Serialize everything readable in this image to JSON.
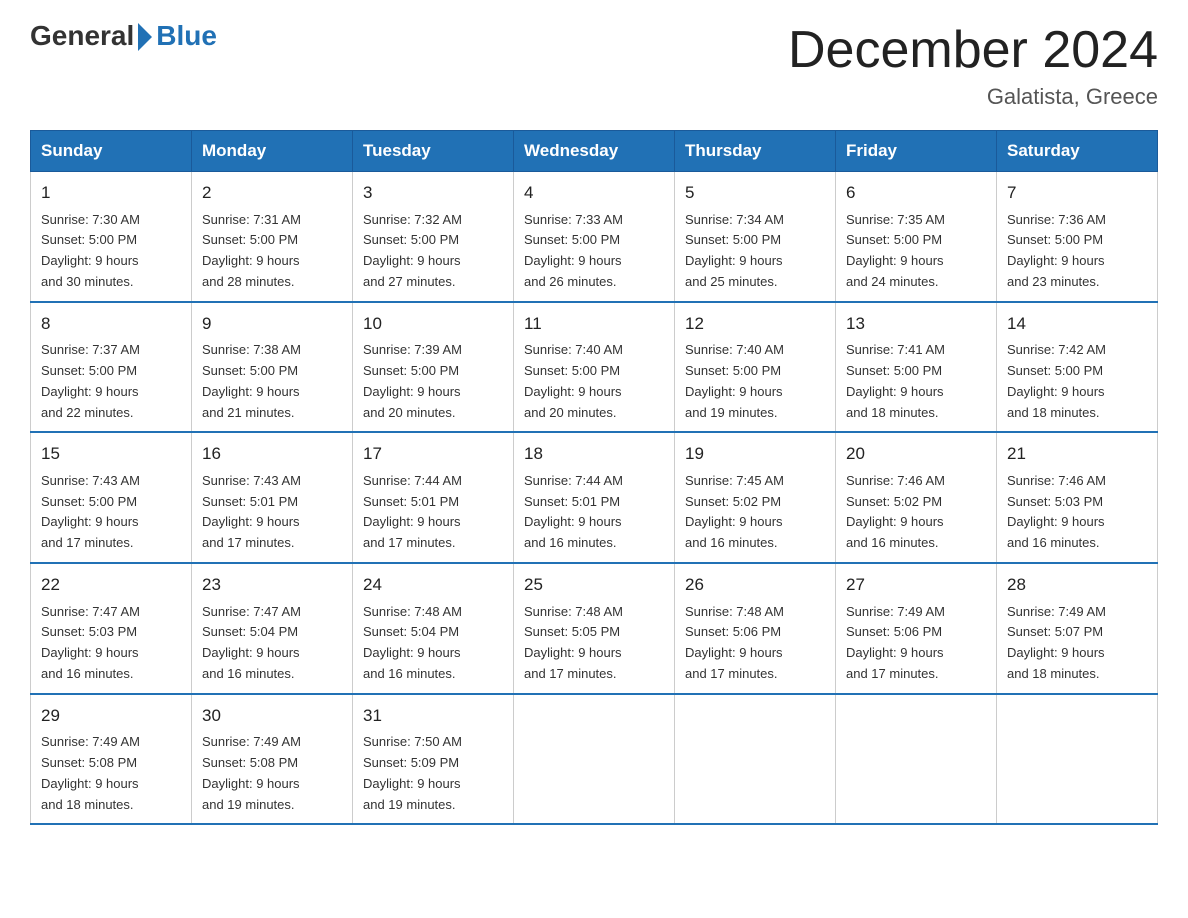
{
  "logo": {
    "general": "General",
    "blue": "Blue"
  },
  "header": {
    "title": "December 2024",
    "subtitle": "Galatista, Greece"
  },
  "days_of_week": [
    "Sunday",
    "Monday",
    "Tuesday",
    "Wednesday",
    "Thursday",
    "Friday",
    "Saturday"
  ],
  "weeks": [
    [
      {
        "day": "1",
        "sunrise": "7:30 AM",
        "sunset": "5:00 PM",
        "daylight": "9 hours and 30 minutes."
      },
      {
        "day": "2",
        "sunrise": "7:31 AM",
        "sunset": "5:00 PM",
        "daylight": "9 hours and 28 minutes."
      },
      {
        "day": "3",
        "sunrise": "7:32 AM",
        "sunset": "5:00 PM",
        "daylight": "9 hours and 27 minutes."
      },
      {
        "day": "4",
        "sunrise": "7:33 AM",
        "sunset": "5:00 PM",
        "daylight": "9 hours and 26 minutes."
      },
      {
        "day": "5",
        "sunrise": "7:34 AM",
        "sunset": "5:00 PM",
        "daylight": "9 hours and 25 minutes."
      },
      {
        "day": "6",
        "sunrise": "7:35 AM",
        "sunset": "5:00 PM",
        "daylight": "9 hours and 24 minutes."
      },
      {
        "day": "7",
        "sunrise": "7:36 AM",
        "sunset": "5:00 PM",
        "daylight": "9 hours and 23 minutes."
      }
    ],
    [
      {
        "day": "8",
        "sunrise": "7:37 AM",
        "sunset": "5:00 PM",
        "daylight": "9 hours and 22 minutes."
      },
      {
        "day": "9",
        "sunrise": "7:38 AM",
        "sunset": "5:00 PM",
        "daylight": "9 hours and 21 minutes."
      },
      {
        "day": "10",
        "sunrise": "7:39 AM",
        "sunset": "5:00 PM",
        "daylight": "9 hours and 20 minutes."
      },
      {
        "day": "11",
        "sunrise": "7:40 AM",
        "sunset": "5:00 PM",
        "daylight": "9 hours and 20 minutes."
      },
      {
        "day": "12",
        "sunrise": "7:40 AM",
        "sunset": "5:00 PM",
        "daylight": "9 hours and 19 minutes."
      },
      {
        "day": "13",
        "sunrise": "7:41 AM",
        "sunset": "5:00 PM",
        "daylight": "9 hours and 18 minutes."
      },
      {
        "day": "14",
        "sunrise": "7:42 AM",
        "sunset": "5:00 PM",
        "daylight": "9 hours and 18 minutes."
      }
    ],
    [
      {
        "day": "15",
        "sunrise": "7:43 AM",
        "sunset": "5:00 PM",
        "daylight": "9 hours and 17 minutes."
      },
      {
        "day": "16",
        "sunrise": "7:43 AM",
        "sunset": "5:01 PM",
        "daylight": "9 hours and 17 minutes."
      },
      {
        "day": "17",
        "sunrise": "7:44 AM",
        "sunset": "5:01 PM",
        "daylight": "9 hours and 17 minutes."
      },
      {
        "day": "18",
        "sunrise": "7:44 AM",
        "sunset": "5:01 PM",
        "daylight": "9 hours and 16 minutes."
      },
      {
        "day": "19",
        "sunrise": "7:45 AM",
        "sunset": "5:02 PM",
        "daylight": "9 hours and 16 minutes."
      },
      {
        "day": "20",
        "sunrise": "7:46 AM",
        "sunset": "5:02 PM",
        "daylight": "9 hours and 16 minutes."
      },
      {
        "day": "21",
        "sunrise": "7:46 AM",
        "sunset": "5:03 PM",
        "daylight": "9 hours and 16 minutes."
      }
    ],
    [
      {
        "day": "22",
        "sunrise": "7:47 AM",
        "sunset": "5:03 PM",
        "daylight": "9 hours and 16 minutes."
      },
      {
        "day": "23",
        "sunrise": "7:47 AM",
        "sunset": "5:04 PM",
        "daylight": "9 hours and 16 minutes."
      },
      {
        "day": "24",
        "sunrise": "7:48 AM",
        "sunset": "5:04 PM",
        "daylight": "9 hours and 16 minutes."
      },
      {
        "day": "25",
        "sunrise": "7:48 AM",
        "sunset": "5:05 PM",
        "daylight": "9 hours and 17 minutes."
      },
      {
        "day": "26",
        "sunrise": "7:48 AM",
        "sunset": "5:06 PM",
        "daylight": "9 hours and 17 minutes."
      },
      {
        "day": "27",
        "sunrise": "7:49 AM",
        "sunset": "5:06 PM",
        "daylight": "9 hours and 17 minutes."
      },
      {
        "day": "28",
        "sunrise": "7:49 AM",
        "sunset": "5:07 PM",
        "daylight": "9 hours and 18 minutes."
      }
    ],
    [
      {
        "day": "29",
        "sunrise": "7:49 AM",
        "sunset": "5:08 PM",
        "daylight": "9 hours and 18 minutes."
      },
      {
        "day": "30",
        "sunrise": "7:49 AM",
        "sunset": "5:08 PM",
        "daylight": "9 hours and 19 minutes."
      },
      {
        "day": "31",
        "sunrise": "7:50 AM",
        "sunset": "5:09 PM",
        "daylight": "9 hours and 19 minutes."
      },
      null,
      null,
      null,
      null
    ]
  ],
  "labels": {
    "sunrise": "Sunrise:",
    "sunset": "Sunset:",
    "daylight": "Daylight:"
  }
}
